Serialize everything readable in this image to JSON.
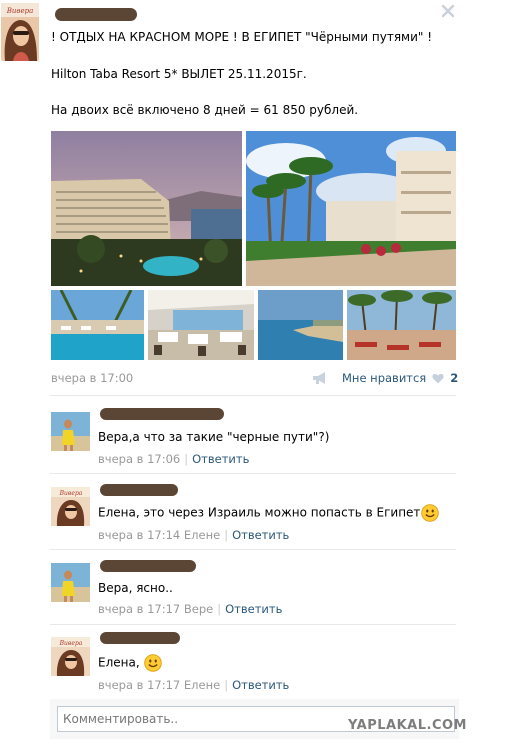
{
  "post": {
    "line1": "! ОТДЫХ НА КРАСНОМ МОРЕ ! В ЕГИПЕТ \"Чёрными путями\" !",
    "line2": "Hilton Taba Resort 5* ВЫЛЕТ 25.11.2015г.",
    "line3": "На двоих всё включено 8 дней = 61 850 рублей.",
    "avatar_logo": "Вивера",
    "date": "вчера в 17:00",
    "like_label": "Мне нравится",
    "like_count": "2",
    "photos": [
      "hotel-bay-photo",
      "palm-promenade-photo",
      "pool-photo",
      "restaurant-photo",
      "sea-beach-photo",
      "beach-loungers-photo"
    ]
  },
  "comments": [
    {
      "text": "Вера,а что за такие \"черные пути\"?)",
      "time": "вчера в 17:06",
      "to": "",
      "reply": "Ответить",
      "avatar": "beach-girl-avatar"
    },
    {
      "text": "Елена, это через Израиль можно попасть в Египет",
      "time": "вчера в 17:14",
      "to": "Елене",
      "reply": "Ответить",
      "avatar": "vivera-avatar"
    },
    {
      "text": "Вера, ясно..",
      "time": "вчера в 17:17",
      "to": "Вере",
      "reply": "Ответить",
      "avatar": "beach-girl-avatar"
    },
    {
      "text": "Елена,",
      "time": "вчера в 17:17",
      "to": "Елене",
      "reply": "Ответить",
      "avatar": "vivera-avatar"
    }
  ],
  "comment_box": {
    "placeholder": "Комментировать.."
  },
  "watermark": "YAPLAKAL.COM",
  "colors": {
    "link": "#2b587a",
    "muted": "#999999",
    "separator": "#e7e8ec",
    "scribble": "#5b4636"
  }
}
